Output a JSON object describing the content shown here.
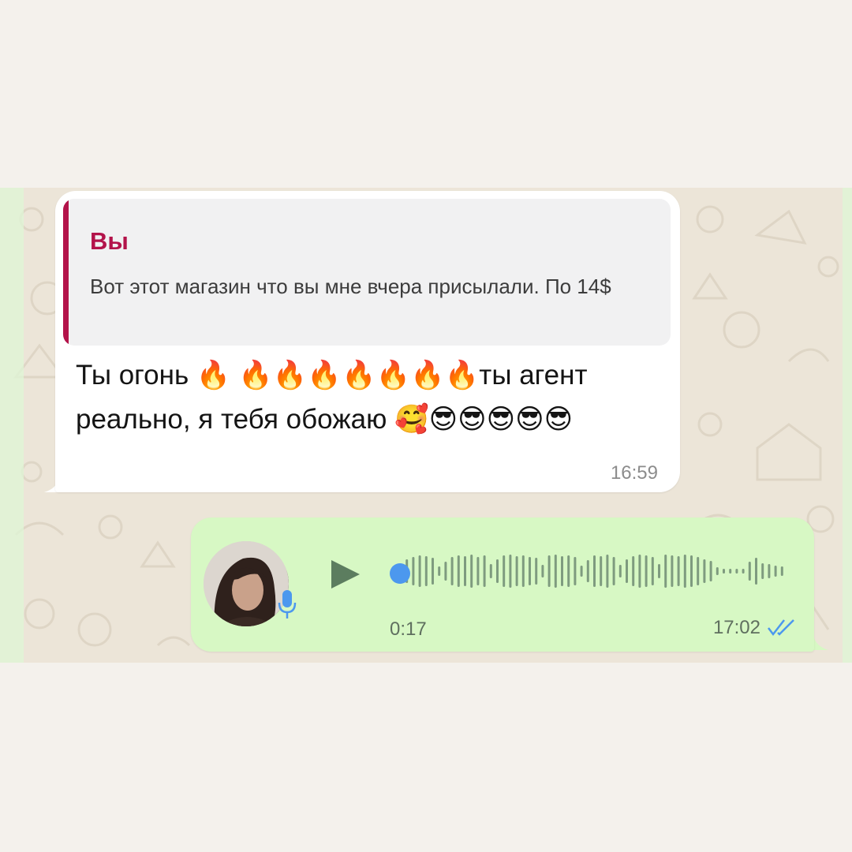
{
  "incoming": {
    "quote": {
      "author": "Вы",
      "text": "Вот этот магазин что вы мне вчера присылали. По 14$"
    },
    "text": "Ты огонь 🔥 🔥🔥🔥🔥🔥🔥🔥ты агент реально, я тебя обожаю 🥰😎😎😎😎😎",
    "time": "16:59"
  },
  "voice_message": {
    "duration": "0:17",
    "time": "17:02",
    "status_icon": "double-check-icon",
    "progress": 0
  },
  "colors": {
    "quote_accent": "#b3134a",
    "incoming_bubble": "#ffffff",
    "outgoing_bubble": "#d7f8c4",
    "play_accent": "#4c98ee",
    "wallpaper": "#ece5d8"
  }
}
